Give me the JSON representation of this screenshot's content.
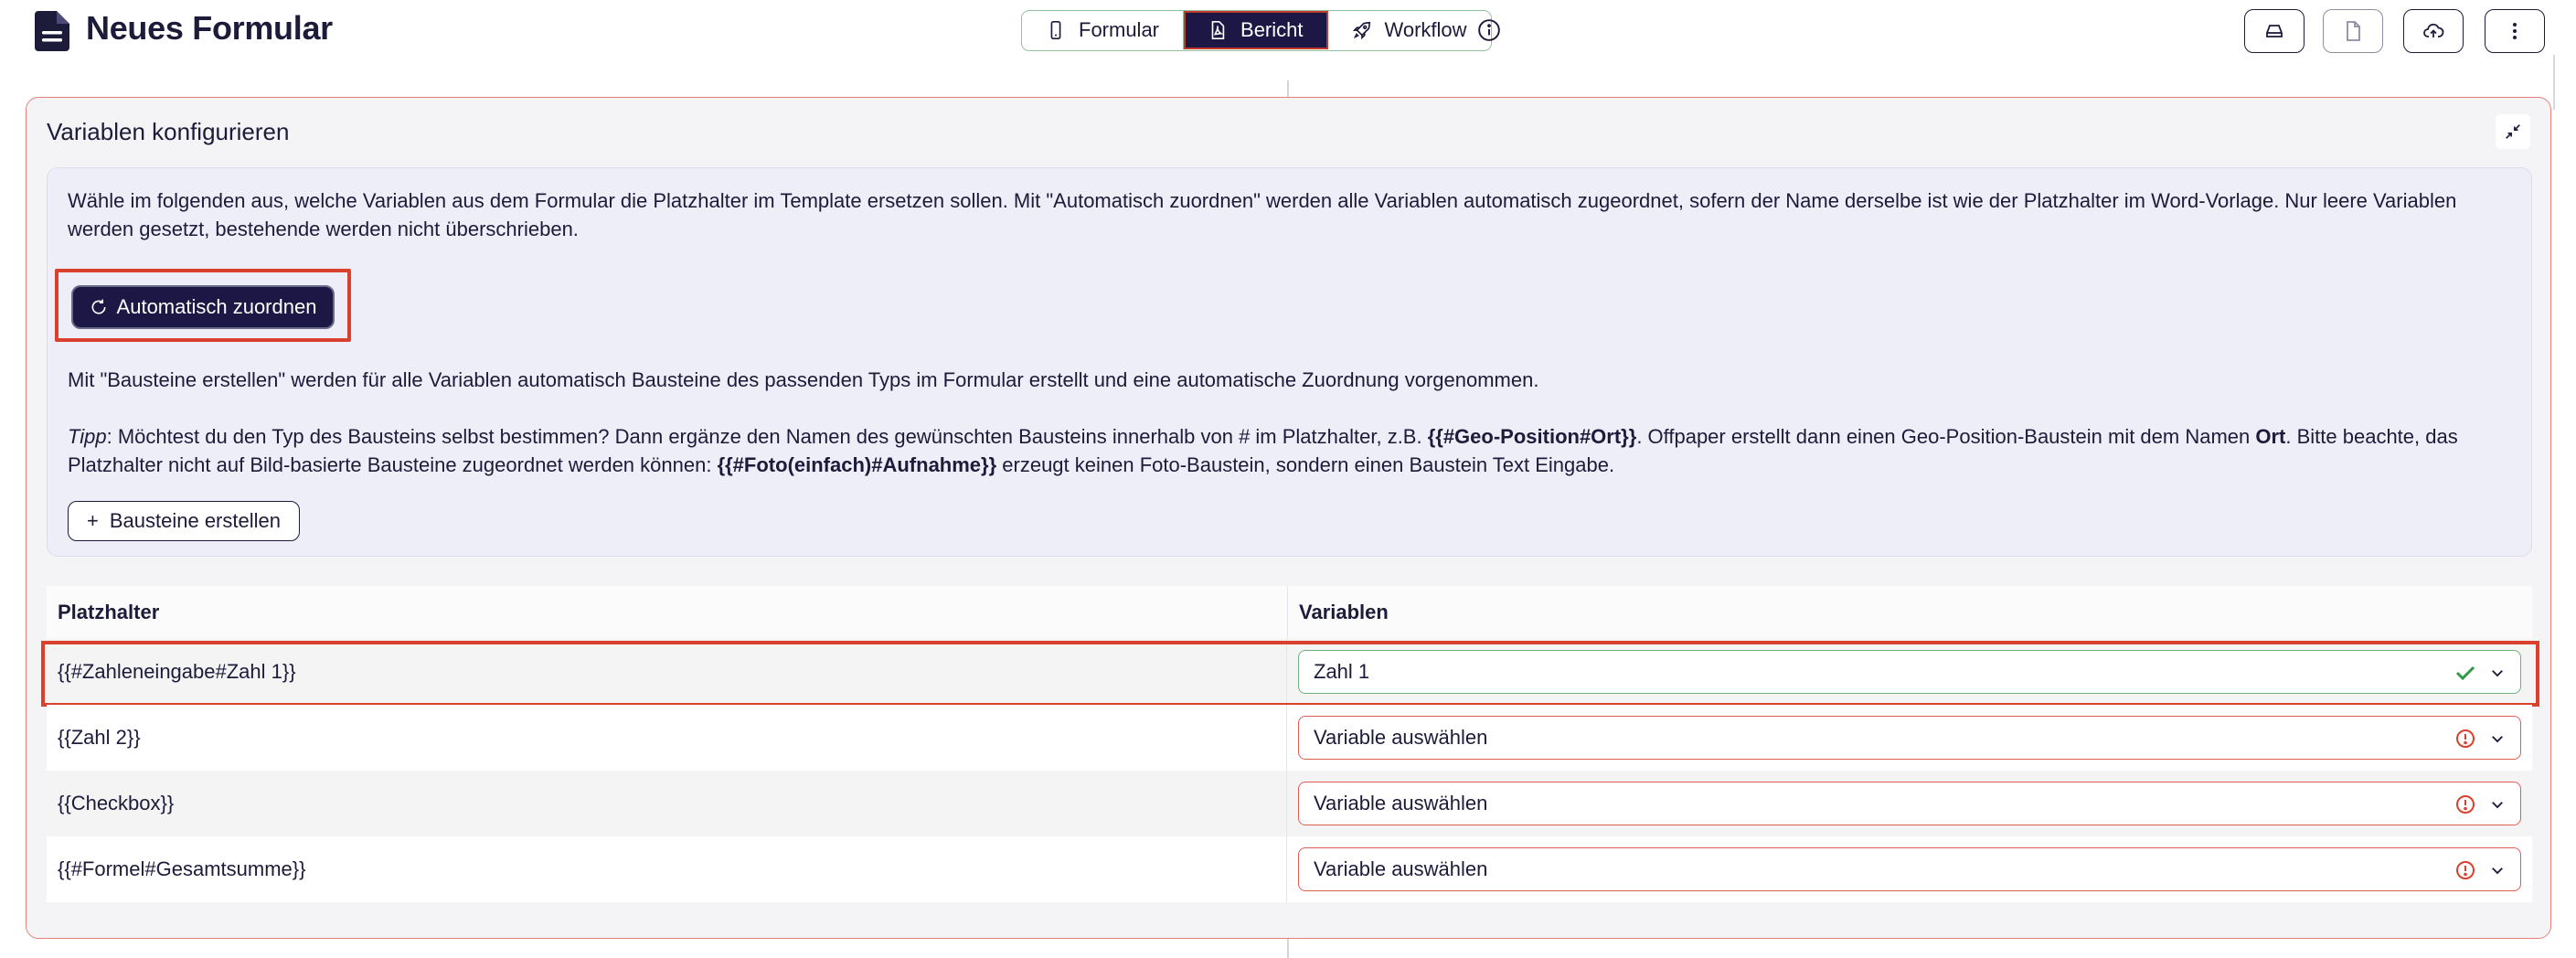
{
  "header": {
    "title": "Neues Formular",
    "tabs": [
      {
        "label": "Formular",
        "icon": "smartphone-icon",
        "active": false
      },
      {
        "label": "Bericht",
        "icon": "pdf-file-icon",
        "active": true
      },
      {
        "label": "Workflow",
        "icon": "rocket-icon",
        "active": false
      }
    ],
    "actions": [
      "drive-icon",
      "file-icon",
      "cloud-upload-icon",
      "more-vertical-icon"
    ]
  },
  "panel": {
    "title": "Variablen konfigurieren",
    "intro": "Wähle im folgenden aus, welche Variablen aus dem Formular die Platzhalter im Template ersetzen sollen. Mit \"Automatisch zuordnen\" werden alle Variablen automatisch zugeordnet, sofern der Name derselbe ist wie der Platzhalter im Word-Vorlage. Nur leere Variablen werden gesetzt, bestehende werden nicht überschrieben.",
    "auto_button": "Automatisch zuordnen",
    "create_text": "Mit \"Bausteine erstellen\" werden für alle Variablen automatisch Bausteine des passenden Typs im Formular erstellt und eine automatische Zuordnung vorgenommen.",
    "tip": {
      "label": "Tipp",
      "t1": ": Möchtest du den Typ des Bausteins selbst bestimmen? Dann ergänze den Namen des gewünschten Bausteins innerhalb von # im Platzhalter, z.B. ",
      "b1": "{{#Geo-Position#Ort}}",
      "t2": ". Offpaper erstellt dann einen Geo-Position-Baustein mit dem Namen ",
      "b2": "Ort",
      "t3": ". Bitte beachte, das Platzhalter nicht auf Bild-basierte Bausteine zugeordnet werden können: ",
      "b3": "{{#Foto(einfach)#Aufnahme}}",
      "t4": " erzeugt keinen Foto-Baustein, sondern einen Baustein Text Eingabe."
    },
    "create_button": "Bausteine erstellen"
  },
  "table": {
    "headers": [
      "Platzhalter",
      "Variablen"
    ],
    "rows": [
      {
        "placeholder": "{{#Zahleneingabe#Zahl 1}}",
        "variable": "Zahl 1",
        "status": "ok"
      },
      {
        "placeholder": "{{Zahl 2}}",
        "variable": "Variable auswählen",
        "status": "error"
      },
      {
        "placeholder": "{{Checkbox}}",
        "variable": "Variable auswählen",
        "status": "error"
      },
      {
        "placeholder": "{{#Formel#Gesamtsumme}}",
        "variable": "Variable auswählen",
        "status": "error"
      }
    ]
  },
  "colors": {
    "primary": "#1c1745",
    "success": "#2e9a45",
    "error": "#d9412e",
    "highlight": "#d9412e"
  }
}
